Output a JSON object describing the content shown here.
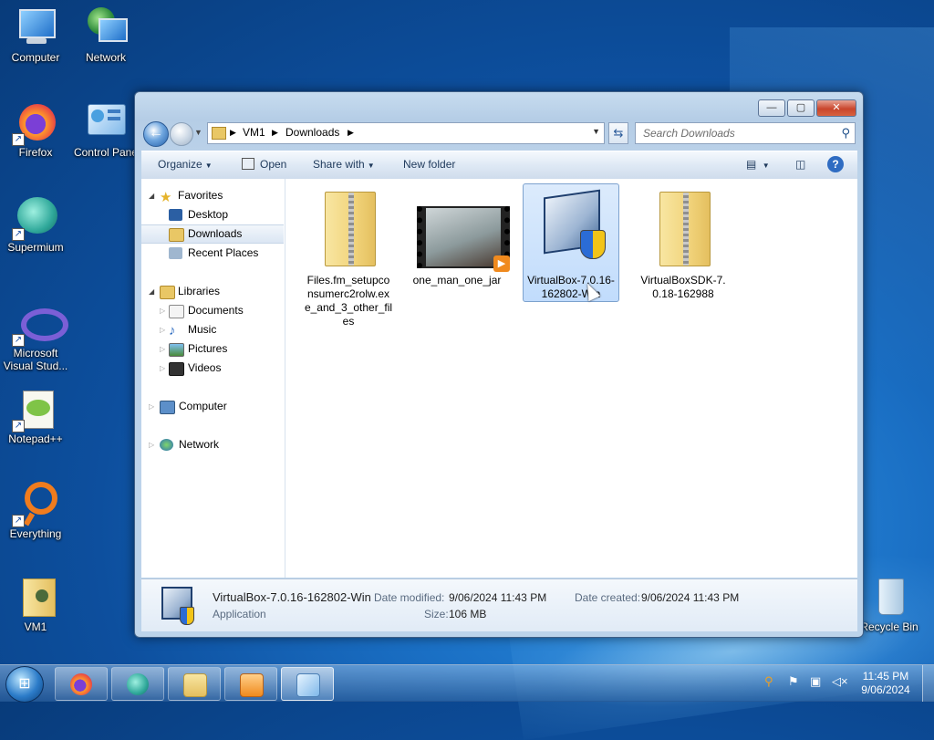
{
  "desktop": {
    "icons": [
      {
        "label": "Computer"
      },
      {
        "label": "Network"
      },
      {
        "label": "Firefox"
      },
      {
        "label": "Control Pane"
      },
      {
        "label": "Supermium"
      },
      {
        "label": "Microsoft Visual Stud..."
      },
      {
        "label": "Notepad++"
      },
      {
        "label": "Everything"
      },
      {
        "label": "VM1"
      },
      {
        "label": "Recycle Bin"
      }
    ]
  },
  "window": {
    "caption_buttons": {
      "minimize": "—",
      "maximize": "▢",
      "close": "✕"
    },
    "address": {
      "crumbs": [
        "VM1",
        "Downloads"
      ]
    },
    "search": {
      "placeholder": "Search Downloads"
    },
    "toolbar": {
      "organize": "Organize",
      "open": "Open",
      "share_with": "Share with",
      "new_folder": "New folder"
    },
    "nav": {
      "favorites": "Favorites",
      "desktop": "Desktop",
      "downloads": "Downloads",
      "recent_places": "Recent Places",
      "libraries": "Libraries",
      "documents": "Documents",
      "music": "Music",
      "pictures": "Pictures",
      "videos": "Videos",
      "computer": "Computer",
      "network": "Network"
    },
    "files": [
      {
        "name": "Files.fm_setupconsumerc2rolw.exe_and_3_other_files",
        "l1": "Files.fm_setupco",
        "l2": "nsumerc2rolw.ex",
        "l3": "e_and_3_other_fil",
        "l4": "es"
      },
      {
        "name": "one_man_one_jar",
        "l1": "one_man_one_jar"
      },
      {
        "name": "VirtualBox-7.0.16-162802-Win",
        "l1": "VirtualBox-7.0.16-",
        "l2": "162802-Win",
        "selected": true
      },
      {
        "name": "VirtualBoxSDK-7.0.18-162988",
        "l1": "VirtualBoxSDK-7.",
        "l2": "0.18-162988"
      }
    ],
    "details": {
      "name": "VirtualBox-7.0.16-162802-Win",
      "type": "Application",
      "modified_label": "Date modified:",
      "modified_value": "9/06/2024 11:43 PM",
      "created_label": "Date created:",
      "created_value": "9/06/2024 11:43 PM",
      "size_label": "Size:",
      "size_value": "106 MB"
    }
  },
  "taskbar": {
    "clock_time": "11:45 PM",
    "clock_date": "9/06/2024"
  }
}
